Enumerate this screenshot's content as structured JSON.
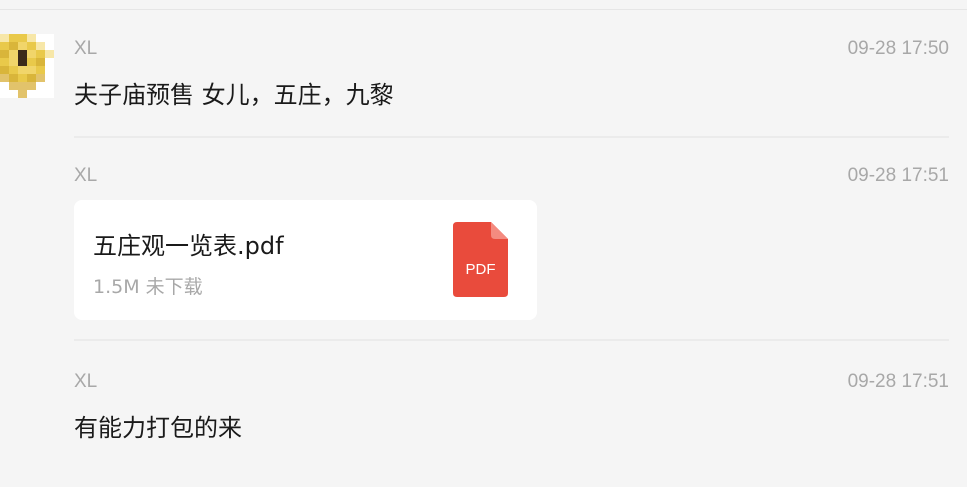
{
  "messages": [
    {
      "sender": "XL",
      "time": "09-28 17:50",
      "text": "夫子庙预售 女儿，五庄，九黎"
    },
    {
      "sender": "XL",
      "time": "09-28 17:51",
      "file": {
        "name": "五庄观一览表.pdf",
        "size": "1.5M",
        "status": "未下载",
        "meta": "1.5M 未下载",
        "icon": "pdf-file-icon",
        "icon_label": "PDF",
        "icon_color": "#e94b3c"
      }
    },
    {
      "sender": "XL",
      "time": "09-28 17:51",
      "text": "有能力打包的来"
    }
  ],
  "avatar": {
    "icon": "pixelated-avatar",
    "colors": [
      "#f7e7a8",
      "#e9c94a",
      "#d9b53a",
      "#b8862e",
      "#3b2a1a",
      "#f1d56a",
      "#ffffff",
      "#e2c36b"
    ]
  }
}
